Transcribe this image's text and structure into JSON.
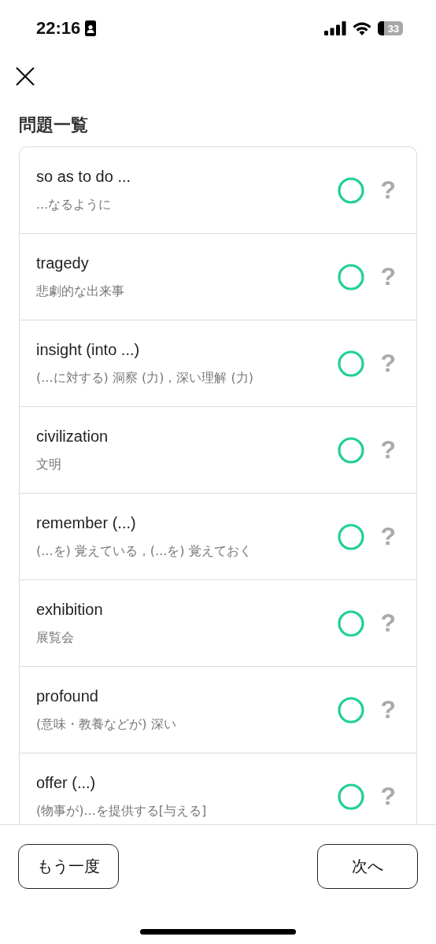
{
  "status_bar": {
    "time": "22:16",
    "battery": "33"
  },
  "title": "問題一覧",
  "questions": [
    {
      "word": "so as to do ...",
      "meaning": "...なるように",
      "correct": true,
      "hint": "?"
    },
    {
      "word": "tragedy",
      "meaning": "悲劇的な出来事",
      "correct": true,
      "hint": "?"
    },
    {
      "word": "insight (into ...)",
      "meaning": "(...に対する) 洞察 (力)，深い理解 (力)",
      "correct": true,
      "hint": "?"
    },
    {
      "word": "civilization",
      "meaning": "文明",
      "correct": true,
      "hint": "?"
    },
    {
      "word": "remember (...)",
      "meaning": "(...を) 覚えている，(...を) 覚えておく",
      "correct": true,
      "hint": "?"
    },
    {
      "word": "exhibition",
      "meaning": "展覧会",
      "correct": true,
      "hint": "?"
    },
    {
      "word": "profound",
      "meaning": "(意味・教養などが) 深い",
      "correct": true,
      "hint": "?"
    },
    {
      "word": "offer (...)",
      "meaning": "(物事が)...を提供する[与える]",
      "correct": true,
      "hint": "?"
    }
  ],
  "buttons": {
    "retry": "もう一度",
    "next": "次へ"
  }
}
